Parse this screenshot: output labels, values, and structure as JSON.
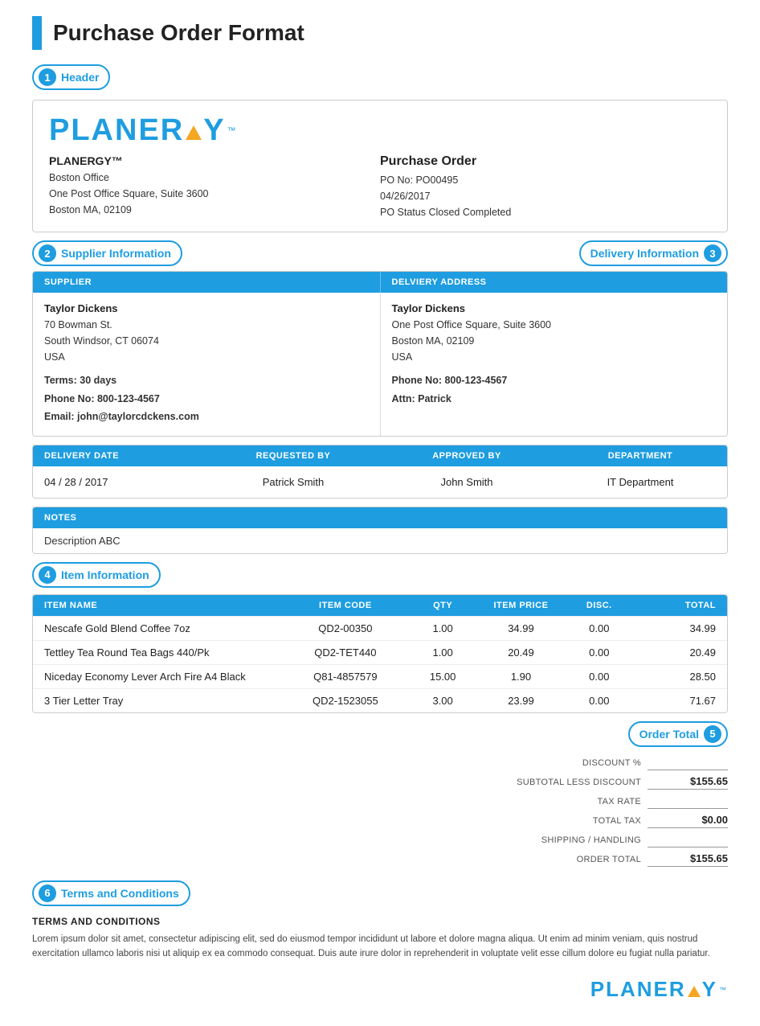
{
  "page": {
    "title": "Purchase Order Format"
  },
  "sections": {
    "header_badge": "Header",
    "supplier_badge": "Supplier Information",
    "delivery_badge": "Delivery Information",
    "item_badge": "Item Information",
    "order_total_badge": "Order Total",
    "terms_badge": "Terms and Conditions"
  },
  "badge_numbers": {
    "header": "1",
    "supplier": "2",
    "delivery": "3",
    "item": "4",
    "order_total": "5",
    "terms": "6"
  },
  "logo": {
    "text_before": "PLANER",
    "text_after": "Y",
    "tm": "™"
  },
  "company": {
    "name": "PLANERGY™",
    "address_line1": "Boston Office",
    "address_line2": "One Post Office Square, Suite 3600",
    "address_line3": "Boston MA, 02109"
  },
  "purchase_order": {
    "title": "Purchase Order",
    "po_no": "PO No: PO00495",
    "date": "04/26/2017",
    "status": "PO Status Closed Completed"
  },
  "supplier": {
    "column_header": "SUPPLIER",
    "name": "Taylor Dickens",
    "address_line1": "70 Bowman St.",
    "address_line2": "South Windsor, CT 06074",
    "address_line3": "USA",
    "terms_label": "Terms:",
    "terms_value": "30 days",
    "phone_label": "Phone No:",
    "phone_value": "800-123-4567",
    "email_label": "Email:",
    "email_value": "john@taylorcdckens.com"
  },
  "delivery": {
    "column_header": "DELVIERY ADDRESS",
    "name": "Taylor Dickens",
    "address_line1": "One Post Office Square, Suite 3600",
    "address_line2": "Boston MA, 02109",
    "address_line3": "USA",
    "phone_label": "Phone No:",
    "phone_value": "800-123-4567",
    "attn_label": "Attn:",
    "attn_value": "Patrick"
  },
  "delivery_meta": {
    "headers": [
      "DELIVERY DATE",
      "REQUESTED BY",
      "APPROVED BY",
      "DEPARTMENT"
    ],
    "values": [
      "04 / 28 / 2017",
      "Patrick Smith",
      "John Smith",
      "IT Department"
    ]
  },
  "notes": {
    "header": "NOTES",
    "content": "Description ABC"
  },
  "items": {
    "headers": [
      "ITEM NAME",
      "ITEM CODE",
      "QTY",
      "ITEM PRICE",
      "DISC.",
      "TOTAL"
    ],
    "rows": [
      {
        "name": "Nescafe Gold Blend Coffee 7oz",
        "code": "QD2-00350",
        "qty": "1.00",
        "price": "34.99",
        "disc": "0.00",
        "total": "34.99"
      },
      {
        "name": "Tettley Tea Round Tea Bags 440/Pk",
        "code": "QD2-TET440",
        "qty": "1.00",
        "price": "20.49",
        "disc": "0.00",
        "total": "20.49"
      },
      {
        "name": "Niceday Economy Lever Arch Fire A4 Black",
        "code": "Q81-4857579",
        "qty": "15.00",
        "price": "1.90",
        "disc": "0.00",
        "total": "28.50"
      },
      {
        "name": "3 Tier Letter Tray",
        "code": "QD2-1523055",
        "qty": "3.00",
        "price": "23.99",
        "disc": "0.00",
        "total": "71.67"
      }
    ]
  },
  "totals": {
    "discount_label": "DISCOUNT %",
    "subtotal_label": "SUBTOTAL LESS DISCOUNT",
    "subtotal_value": "$155.65",
    "tax_rate_label": "TAX RATE",
    "total_tax_label": "TOTAL TAX",
    "total_tax_value": "$0.00",
    "shipping_label": "SHIPPING / HANDLING",
    "order_total_label": "ORDER TOTAL",
    "order_total_value": "$155.65"
  },
  "terms": {
    "header": "TERMS AND CONDITIONS",
    "body": "Lorem ipsum dolor sit amet, consectetur adipiscing elit, sed do eiusmod tempor incididunt ut labore et dolore magna aliqua. Ut enim ad minim veniam, quis nostrud exercitation ullamco laboris nisi ut aliquip ex ea commodo consequat. Duis aute irure dolor in reprehenderit in voluptate velit esse cillum dolore eu fugiat nulla pariatur."
  },
  "footer_logo": "PLANERGY™"
}
